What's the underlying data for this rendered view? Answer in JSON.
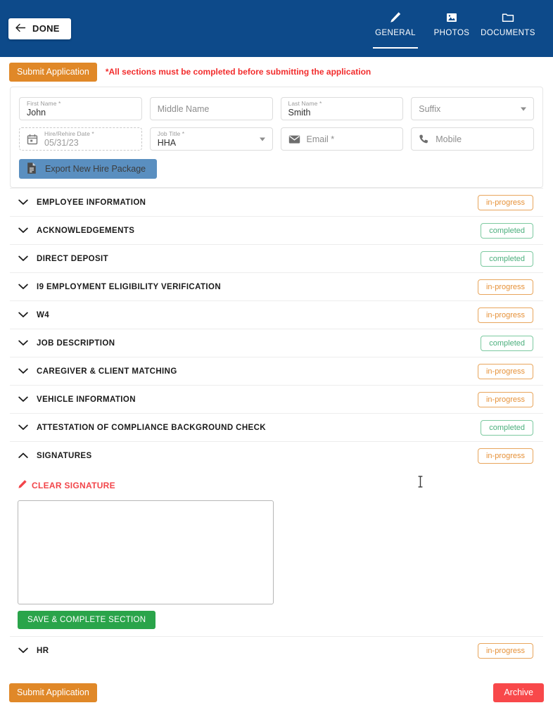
{
  "header": {
    "back_button": {
      "label": "DONE",
      "icon": "arrow-left-icon"
    },
    "tabs": [
      {
        "label": "GENERAL",
        "icon": "pencil-icon",
        "active": true
      },
      {
        "label": "PHOTOS",
        "icon": "image-icon",
        "active": false
      },
      {
        "label": "DOCUMENTS",
        "icon": "folder-icon",
        "active": false
      }
    ],
    "bg_color": "#0d4a8a"
  },
  "submit_bar": {
    "submit_label": "Submit Application",
    "warning_text": "*All sections must be completed before submitting the application",
    "warning_color": "#f22c2c",
    "button_color": "#e08828"
  },
  "form": {
    "first_name": {
      "label": "First Name *",
      "value": "John"
    },
    "middle_name": {
      "placeholder": "Middle Name",
      "value": ""
    },
    "last_name": {
      "label": "Last Name *",
      "value": "Smith"
    },
    "suffix": {
      "placeholder": "Suffix",
      "value": "",
      "icon": "chevron-down-icon"
    },
    "hire_date": {
      "label": "Hire/Rehire Date *",
      "value": "05/31/23",
      "icon": "calendar-icon"
    },
    "job_title": {
      "label": "Job Title *",
      "value": "HHA",
      "icon": "chevron-down-icon"
    },
    "email": {
      "placeholder": "Email *",
      "value": "",
      "icon": "mail-icon"
    },
    "mobile": {
      "placeholder": "Mobile",
      "value": "",
      "icon": "phone-icon"
    },
    "export_button": {
      "label": "Export New Hire Package",
      "icon": "document-icon",
      "color": "#5a8fc0"
    }
  },
  "sections": [
    {
      "title": "EMPLOYEE INFORMATION",
      "status": "in-progress",
      "expanded": false
    },
    {
      "title": "ACKNOWLEDGEMENTS",
      "status": "completed",
      "expanded": false
    },
    {
      "title": "DIRECT DEPOSIT",
      "status": "completed",
      "expanded": false
    },
    {
      "title": "I9 EMPLOYMENT ELIGIBILITY VERIFICATION",
      "status": "in-progress",
      "expanded": false
    },
    {
      "title": "W4",
      "status": "in-progress",
      "expanded": false
    },
    {
      "title": "JOB DESCRIPTION",
      "status": "completed",
      "expanded": false
    },
    {
      "title": "CAREGIVER & CLIENT MATCHING",
      "status": "in-progress",
      "expanded": false
    },
    {
      "title": "VEHICLE INFORMATION",
      "status": "in-progress",
      "expanded": false
    },
    {
      "title": "ATTESTATION OF COMPLIANCE BACKGROUND CHECK",
      "status": "completed",
      "expanded": false
    },
    {
      "title": "SIGNATURES",
      "status": "in-progress",
      "expanded": true
    },
    {
      "title": "HR",
      "status": "in-progress",
      "expanded": false
    }
  ],
  "signature_panel": {
    "clear_label": "CLEAR SIGNATURE",
    "clear_icon": "pencil-icon",
    "clear_color": "#f2454a",
    "save_label": "SAVE & COMPLETE SECTION",
    "save_color": "#2aa44a"
  },
  "footer": {
    "submit_label": "Submit Application",
    "submit_color": "#e08828",
    "archive_label": "Archive",
    "archive_color": "#f8484a"
  },
  "badge_colors": {
    "in_progress": "#e69138",
    "completed": "#4caf7d"
  }
}
